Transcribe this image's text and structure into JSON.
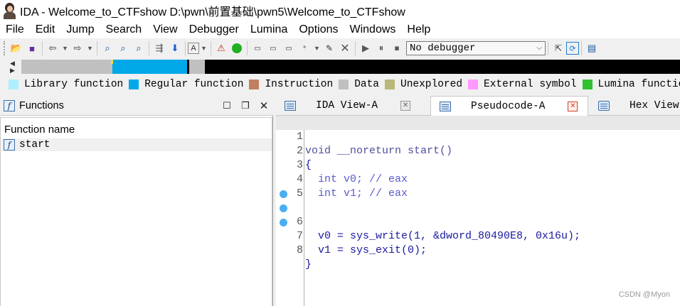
{
  "window": {
    "title": "IDA - Welcome_to_CTFshow D:\\pwn\\前置基础\\pwn5\\Welcome_to_CTFshow"
  },
  "menu": [
    "File",
    "Edit",
    "Jump",
    "Search",
    "View",
    "Debugger",
    "Lumina",
    "Options",
    "Windows",
    "Help"
  ],
  "toolbar": {
    "debugger_value": "No debugger"
  },
  "legend": [
    {
      "label": "Library function",
      "color": "#aeeeff"
    },
    {
      "label": "Regular function",
      "color": "#00a8e8"
    },
    {
      "label": "Instruction",
      "color": "#c08060"
    },
    {
      "label": "Data",
      "color": "#c0c0c0"
    },
    {
      "label": "Unexplored",
      "color": "#b8b878"
    },
    {
      "label": "External symbol",
      "color": "#ff98ff"
    },
    {
      "label": "Lumina function",
      "color": "#30c030"
    }
  ],
  "functions_panel": {
    "title": "Functions",
    "column_header": "Function name",
    "rows": [
      "start"
    ]
  },
  "tabs": [
    {
      "label": "IDA View-A",
      "active": false
    },
    {
      "label": "Pseudocode-A",
      "active": true
    },
    {
      "label": "Hex View",
      "active": false
    }
  ],
  "code": {
    "line_numbers": [
      "1",
      "2",
      "3",
      "4",
      "5",
      "6",
      "7",
      "8"
    ],
    "lines": [
      "void __noreturn start()",
      "{",
      "  int v0; // eax",
      "  int v1; // eax",
      "",
      "  v0 = sys_write(1, &dword_80490E8, 0x16u);",
      "  v1 = sys_exit(0);",
      "}"
    ]
  },
  "watermark": "CSDN @Myon⁠"
}
